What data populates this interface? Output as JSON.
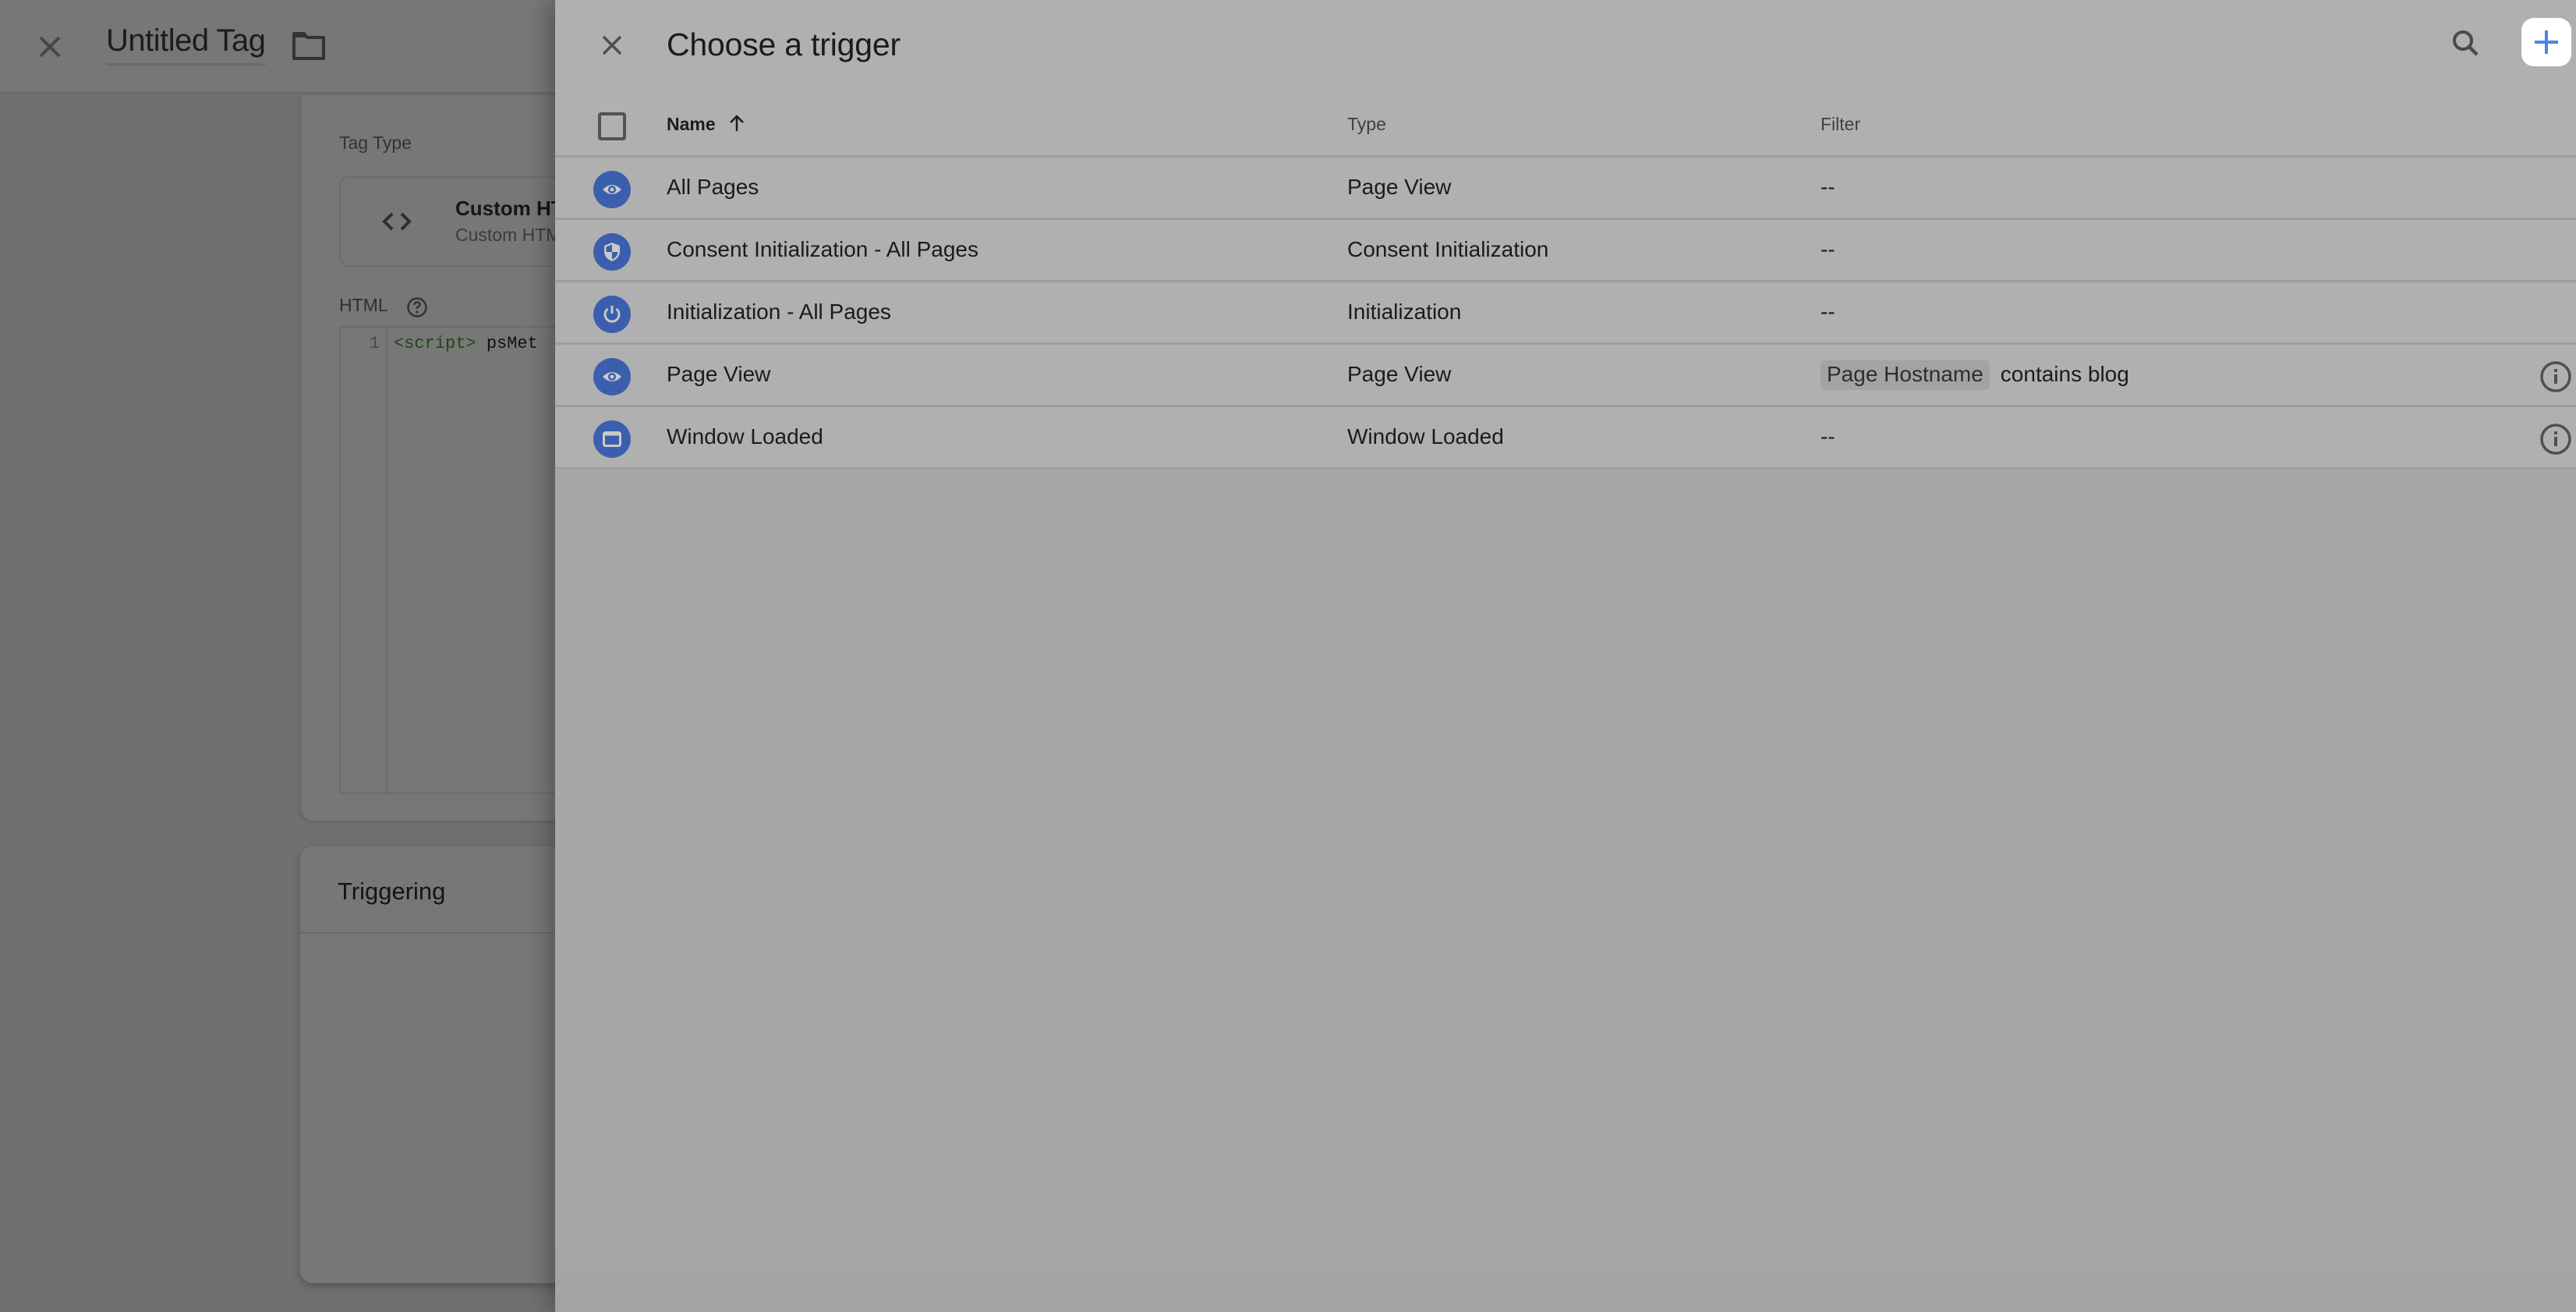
{
  "editor": {
    "tag_title": "Untitled Tag",
    "tag_type_label": "Tag Type",
    "tag_type_name": "Custom HTML",
    "tag_type_subtitle": "Custom HTML",
    "html_label": "HTML",
    "code": {
      "line_number": "1",
      "tag": "<script>",
      "text": " psMet"
    },
    "triggering_title": "Triggering"
  },
  "panel": {
    "title": "Choose a trigger",
    "columns": {
      "name": "Name",
      "type": "Type",
      "filter": "Filter"
    },
    "sort": {
      "column": "name",
      "direction": "ascending"
    },
    "rows": [
      {
        "icon": "eye-icon",
        "name": "All Pages",
        "type": "Page View",
        "filter": "--",
        "filter_chip": "",
        "filter_rest": "",
        "has_info": false
      },
      {
        "icon": "shield-icon",
        "name": "Consent Initialization - All Pages",
        "type": "Consent Initialization",
        "filter": "--",
        "filter_chip": "",
        "filter_rest": "",
        "has_info": false
      },
      {
        "icon": "power-icon",
        "name": "Initialization - All Pages",
        "type": "Initialization",
        "filter": "--",
        "filter_chip": "",
        "filter_rest": "",
        "has_info": false
      },
      {
        "icon": "eye-icon",
        "name": "Page View",
        "type": "Page View",
        "filter": "",
        "filter_chip": "Page Hostname",
        "filter_rest": "contains blog",
        "has_info": true
      },
      {
        "icon": "window-icon",
        "name": "Window Loaded",
        "type": "Window Loaded",
        "filter": "--",
        "filter_chip": "",
        "filter_rest": "",
        "has_info": true
      }
    ]
  },
  "colors": {
    "accent": "#4a84e8",
    "trigger_icon_bg": "#3b5fae",
    "panel_bg": "#b0b0b0",
    "scrim_bg": "#777777"
  }
}
